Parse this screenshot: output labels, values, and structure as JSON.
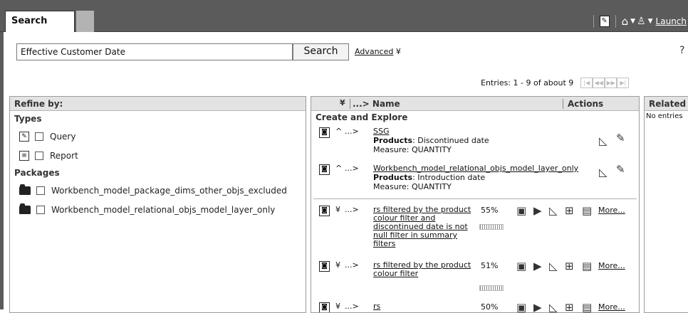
{
  "topbar": {
    "tab_label": "Search",
    "launch_label": "Launch"
  },
  "search": {
    "value": "Effective Customer Date",
    "button_label": "Search",
    "advanced_label": "Advanced"
  },
  "entries_label": "Entries: 1 - 9 of about 9",
  "refine": {
    "header": "Refine by:",
    "types_title": "Types",
    "types": [
      {
        "label": "Query",
        "icon": "query-icon"
      },
      {
        "label": "Report",
        "icon": "report-icon"
      }
    ],
    "packages_title": "Packages",
    "packages": [
      {
        "label": "Workbench_model_package_dims_other_objs_excluded",
        "icon": "folder-icon"
      },
      {
        "label": "Workbench_model_relational_objs_model_layer_only",
        "icon": "folder-icon"
      }
    ]
  },
  "results": {
    "crumb_header": "...> Name",
    "actions_header": "Actions",
    "section_title": "Create and Explore",
    "items": [
      {
        "crumb": "...>",
        "name": "SSG",
        "line1_key": "Products",
        "line1_val": ": Discontinued date",
        "line2": "Measure: QUANTITY"
      },
      {
        "crumb": "...>",
        "name": "Workbench_model_relational_objs_model_layer_only",
        "line1_key": "Products",
        "line1_val": ": Introduction date",
        "line2": "Measure: QUANTITY"
      },
      {
        "crumb": "...>",
        "name_lines": [
          "rs filtered by the product",
          "colour filter and",
          "discontinued date is not",
          "null filter in summary",
          "filters"
        ],
        "percent": "55%",
        "relevance": 0.55,
        "more": "More..."
      },
      {
        "crumb": "...>",
        "name_lines": [
          "rs filtered by the product",
          "colour filter"
        ],
        "percent": "51%",
        "relevance": 0.51,
        "more": "More..."
      },
      {
        "crumb": "...>",
        "name": "rs",
        "percent": "50%",
        "relevance": 0.5,
        "more": "More..."
      }
    ]
  },
  "related": {
    "header": "Related",
    "body": "No entries"
  }
}
